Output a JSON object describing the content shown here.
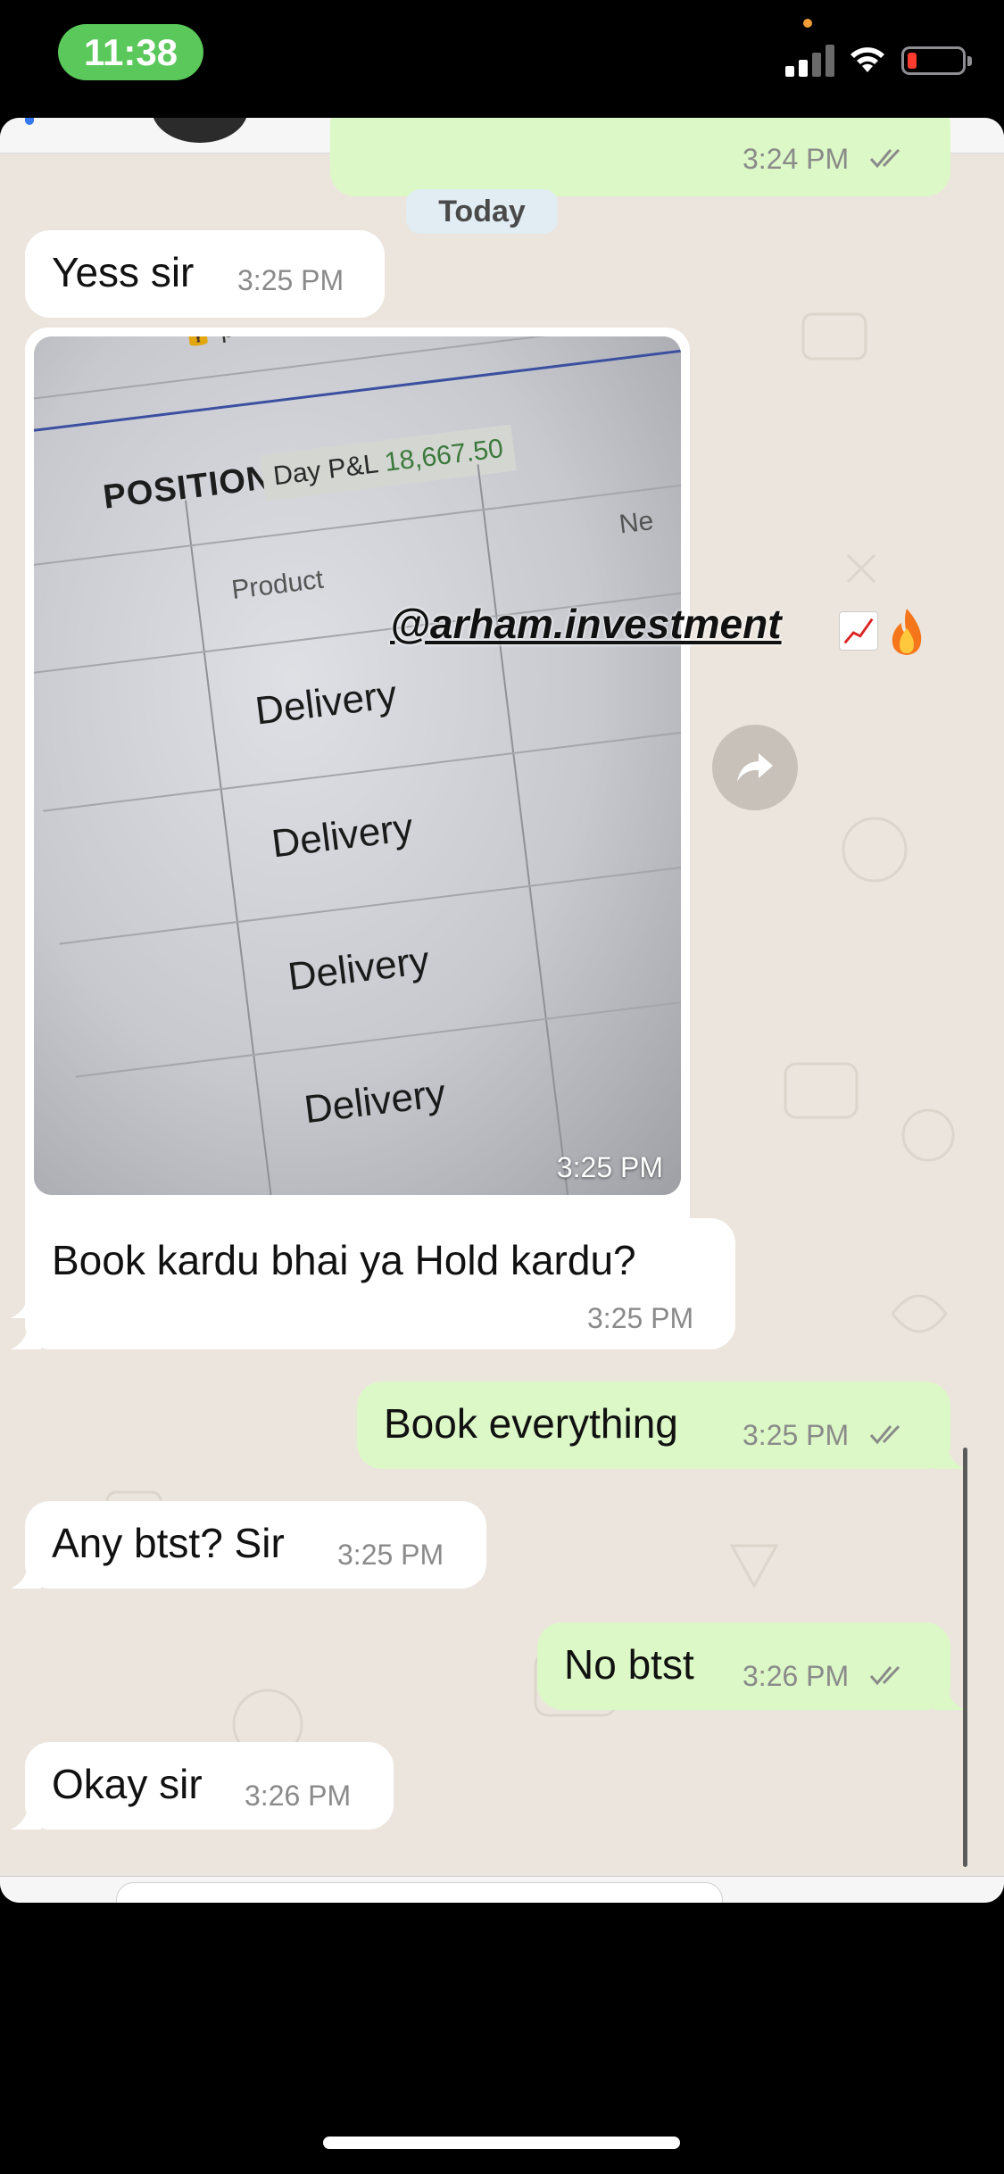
{
  "status_bar": {
    "time": "11:38"
  },
  "date_separator": "Today",
  "messages": [
    {
      "direction": "outgoing",
      "time": "3:24 PM",
      "read": true
    },
    {
      "direction": "incoming",
      "text": "Yess sir",
      "time": "3:25 PM"
    },
    {
      "direction": "incoming",
      "type": "image",
      "time": "3:25 PM",
      "image_text": {
        "header": "POSITIONS",
        "pnl_label": "Day P&L",
        "pnl_value": "18,667.50",
        "column": "Product",
        "column_partial": "Ne",
        "rows": [
          "Delivery",
          "Delivery",
          "Delivery",
          "Delivery"
        ],
        "top_partial": "pro"
      }
    },
    {
      "direction": "incoming",
      "text": "Book kardu bhai ya Hold kardu?",
      "time": "3:25 PM"
    },
    {
      "direction": "outgoing",
      "text": "Book everything",
      "time": "3:25 PM",
      "read": true
    },
    {
      "direction": "incoming",
      "text": "Any btst? Sir",
      "time": "3:25 PM"
    },
    {
      "direction": "outgoing",
      "text": "No btst",
      "time": "3:26 PM",
      "read": true
    },
    {
      "direction": "incoming",
      "text": "Okay sir",
      "time": "3:26 PM"
    }
  ],
  "overlay": {
    "handle": "@arham.investment",
    "emojis": [
      "chart-increasing-emoji",
      "fire-emoji"
    ]
  },
  "icons": {
    "forward": "forward-arrow-icon",
    "read_receipt": "double-check-icon"
  },
  "colors": {
    "incoming_bubble": "#ffffff",
    "outgoing_bubble": "#dcf8c6",
    "chat_background": "#ece5dd",
    "time_pill": "#5ac85a",
    "read_ticks": "#8a8a8a"
  }
}
